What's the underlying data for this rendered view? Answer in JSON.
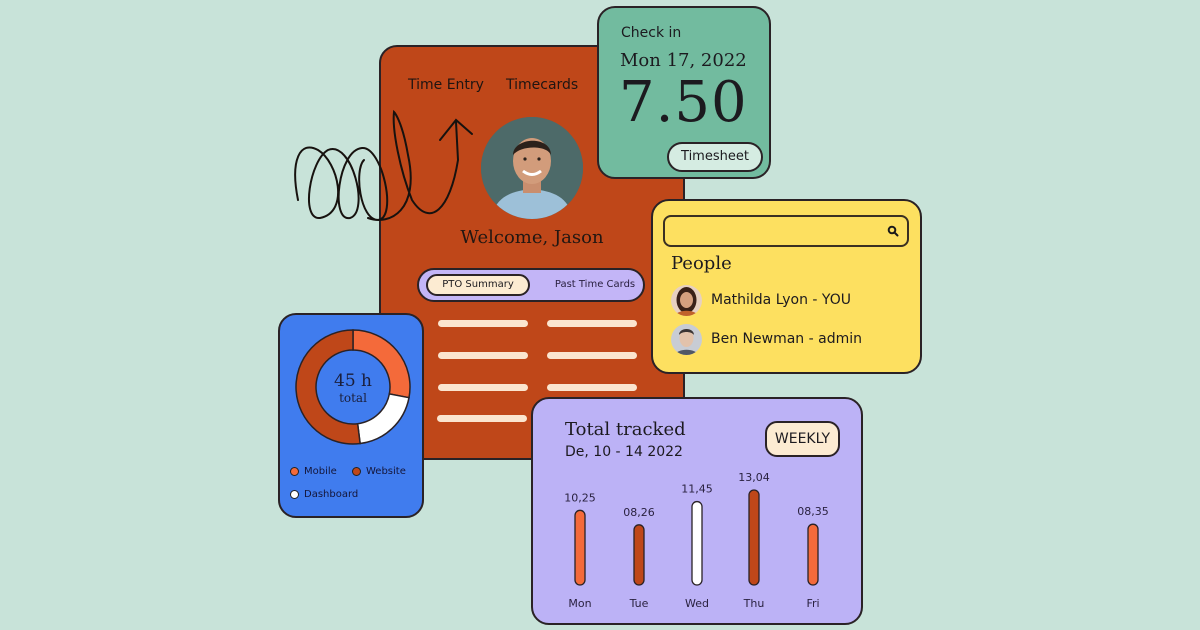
{
  "main_card": {
    "nav": [
      "Time Entry",
      "Timecards"
    ],
    "welcome": "Welcome, Jason",
    "avatar": "jason-photo",
    "tabs": [
      {
        "label": "PTO Summary",
        "active": true
      },
      {
        "label": "Past Time Cards",
        "active": false
      }
    ],
    "placeholder_rows": 4
  },
  "checkin": {
    "label": "Check in",
    "date": "Mon 17, 2022",
    "hours": "7.50",
    "button": "Timesheet"
  },
  "people": {
    "search_placeholder": "",
    "search_icon": "search-icon",
    "title": "People",
    "list": [
      {
        "name": "Mathilda Lyon - YOU"
      },
      {
        "name": "Ben Newman - admin"
      }
    ]
  },
  "donut": {
    "value": "45 h",
    "sub": "total",
    "legend": [
      {
        "label": "Mobile",
        "color": "#f46a3a"
      },
      {
        "label": "Website",
        "color": "#bf4719"
      },
      {
        "label": "Dashboard",
        "color": "#ffffff"
      }
    ]
  },
  "tracked": {
    "title": "Total tracked",
    "subtitle": "De, 10 - 14 2022",
    "button": "WEEKLY"
  },
  "colors": {
    "background": "#c8e3d9",
    "orange": "#bf4719",
    "coral": "#f46a3a",
    "green": "#72bb9f",
    "yellow": "#fde060",
    "blue": "#407cee",
    "lavender": "#bcb2f6",
    "cream": "#fcebd2"
  },
  "chart_data": [
    {
      "type": "pie",
      "title": "45 h total",
      "categories": [
        "Mobile",
        "Dashboard",
        "Website"
      ],
      "values": [
        28,
        20,
        52
      ],
      "unit": "percent",
      "colors": [
        "#f46a3a",
        "#ffffff",
        "#bf4719"
      ]
    },
    {
      "type": "bar",
      "title": "Total tracked",
      "subtitle": "De, 10 - 14 2022",
      "categories": [
        "Mon",
        "Tue",
        "Wed",
        "Thu",
        "Fri"
      ],
      "values": [
        10.25,
        8.26,
        11.45,
        13.04,
        8.35
      ],
      "labels": [
        "10,25",
        "08,26",
        "11,45",
        "13,04",
        "08,35"
      ],
      "colors": [
        "#f46a3a",
        "#bf4719",
        "#ffffff",
        "#bf4719",
        "#f46a3a"
      ],
      "xlabel": "",
      "ylabel": "",
      "ylim": [
        0,
        14
      ],
      "grid": false
    }
  ]
}
